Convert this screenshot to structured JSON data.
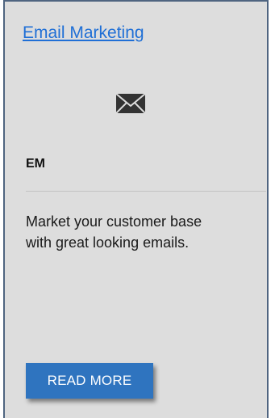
{
  "card": {
    "title": "Email Marketing",
    "icon": "envelope-icon",
    "abbreviation": "EM",
    "description": "Market your customer base with great looking emails.",
    "button_label": "READ MORE"
  },
  "colors": {
    "card_background": "#dddddd",
    "card_border": "#4f6480",
    "link": "#1f6fd6",
    "button_background": "#2f74bf",
    "button_text": "#ffffff",
    "icon": "#333333"
  }
}
